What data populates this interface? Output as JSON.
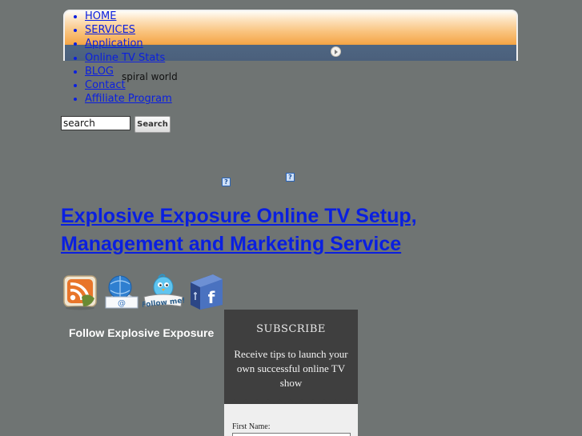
{
  "menu": {
    "items": [
      {
        "label": "HOME"
      },
      {
        "label": "SERVICES"
      },
      {
        "label": "Application"
      },
      {
        "label": "Online TV Stats"
      },
      {
        "label": "BLOG"
      },
      {
        "label": "Contact"
      },
      {
        "label": "Affiliate Program"
      }
    ]
  },
  "site": {
    "name": "spiral world"
  },
  "search": {
    "value": "search",
    "button_label": "Search"
  },
  "broken_images": {
    "glyph": "?"
  },
  "headline": {
    "text": "Explosive Exposure Online TV Setup, Management and Marketing Service"
  },
  "social": {
    "icons": [
      "rss-icon",
      "email-icon",
      "twitter-follow-me-icon",
      "facebook-icon"
    ],
    "follow_text": "Follow Explosive Exposure"
  },
  "subscribe": {
    "title": "SUBSCRIBE",
    "description": "Receive tips to launch your own successful online TV show",
    "first_name_label": "First Name:"
  },
  "colors": {
    "page_background": "#6f7473",
    "link": "#0a1fe0",
    "nav_orange": "#f5a84c",
    "nav_blue": "#4f6682",
    "subscribe_dark": "#3f3f3f"
  }
}
